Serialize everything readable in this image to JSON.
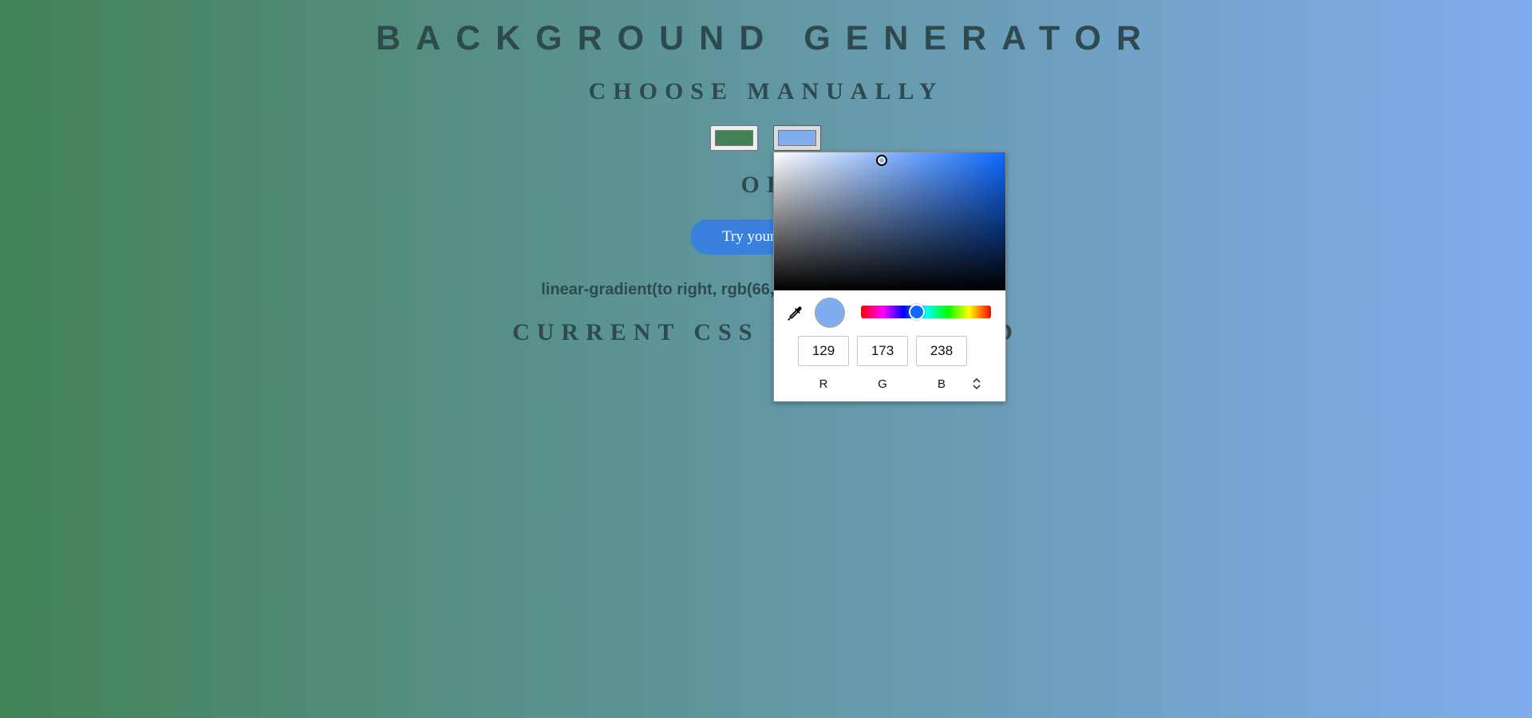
{
  "header": {
    "title": "BACKGROUND GENERATOR",
    "choose_label": "CHOOSE MANUALLY",
    "or_label": "OR",
    "random_button_label": "Try your luck!"
  },
  "color_inputs": [
    {
      "value": "#428256"
    },
    {
      "value": "#81adee"
    }
  ],
  "css_output": "linear-gradient(to right, rgb(66, 130, 86), rgb(129, 173, 238));",
  "current_label": "CURRENT CSS BACKGROUND",
  "picker": {
    "hue_color": "#0d69ff",
    "selected_color": "#81adee",
    "hue_fraction": 0.43,
    "channels": [
      {
        "label": "R",
        "value": "129"
      },
      {
        "label": "G",
        "value": "173"
      },
      {
        "label": "B",
        "value": "238"
      }
    ],
    "icons": [
      "eyedropper-icon",
      "chevron-up-down-icon"
    ]
  }
}
